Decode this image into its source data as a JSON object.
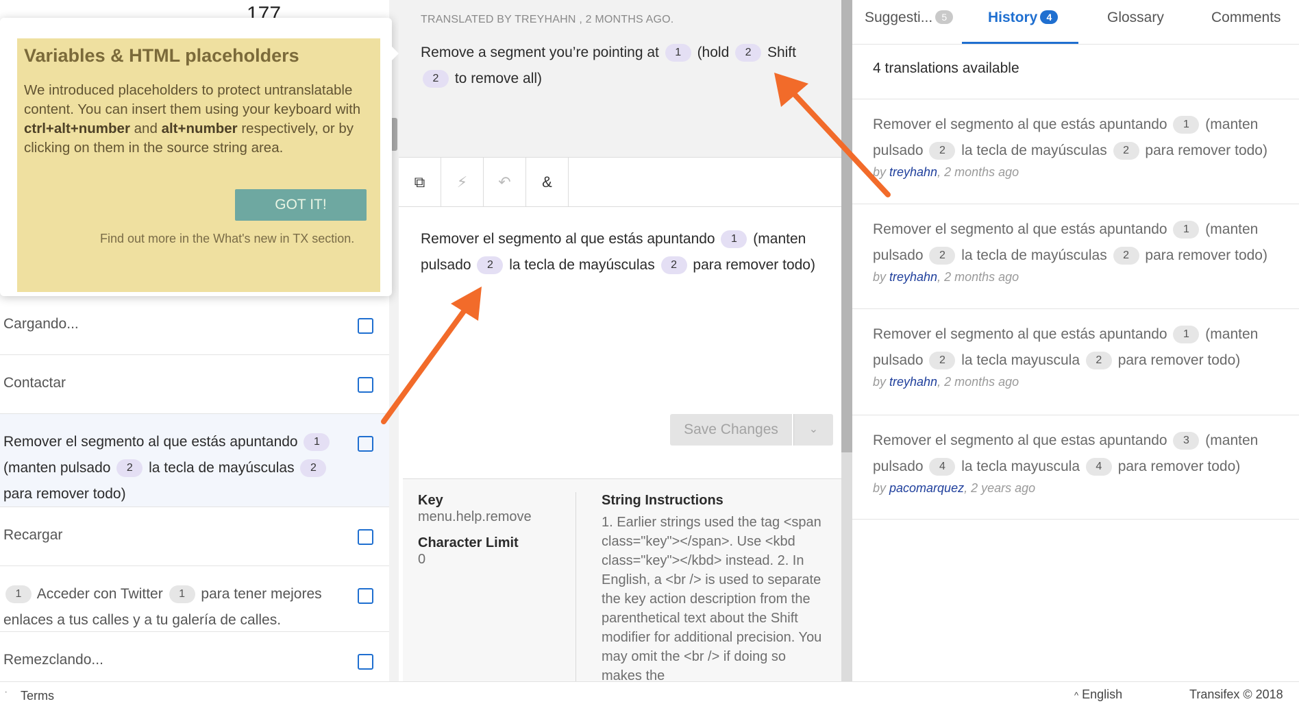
{
  "left": {
    "top_number": "177",
    "items": [
      {
        "text": "Cargando..."
      },
      {
        "text": "Contactar"
      },
      {
        "parts": [
          {
            "t": "Remover el segmento al que estás apuntando"
          },
          {
            "ph": "1"
          },
          {
            "t": "(manten pulsado"
          },
          {
            "ph": "2"
          },
          {
            "t": "la tecla de mayúsculas"
          },
          {
            "ph": "2"
          },
          {
            "t": "para remover todo)"
          }
        ]
      },
      {
        "text": "Recargar"
      },
      {
        "parts": [
          {
            "phg": "1"
          },
          {
            "t": "Acceder con Twitter"
          },
          {
            "phg": "1"
          },
          {
            "t": "para tener mejores enlaces a tus calles y a tu galería de calles."
          }
        ]
      },
      {
        "text": "Remezclando..."
      }
    ]
  },
  "popup": {
    "title": "Variables & HTML placeholders",
    "body_1": "We introduced placeholders to protect untranslatable content. You can insert them using your keyboard with ",
    "body_b1": "ctrl+alt+number",
    "body_2": " and ",
    "body_b2": "alt+number",
    "body_3": " respectively, or by clicking on them in the source string area.",
    "button": "GOT IT!",
    "more": "Find out more in the What's new in TX section."
  },
  "source": {
    "meta": "TRANSLATED BY TREYHAHN , 2 MONTHS AGO.",
    "parts": [
      {
        "t": "Remove a segment you’re pointing at"
      },
      {
        "ph": "1"
      },
      {
        "t": "(hold"
      },
      {
        "ph": "2"
      },
      {
        "t": "Shift"
      },
      {
        "ph": "2"
      },
      {
        "t": "to remove all)"
      }
    ]
  },
  "toolbar": {
    "copy_icon": "⧉",
    "auto_icon": "⚡",
    "undo_icon": "↶",
    "amp_icon": "&"
  },
  "editor": {
    "parts": [
      {
        "t": "Remover el segmento al que estás apuntando"
      },
      {
        "ph": "1"
      },
      {
        "t": "(manten pulsado"
      },
      {
        "ph": "2"
      },
      {
        "t": "la tecla de mayúsculas"
      },
      {
        "ph": "2"
      },
      {
        "t": "para remover todo)"
      }
    ],
    "save_label": "Save Changes",
    "caret": "⌄"
  },
  "details": {
    "key_label": "Key",
    "key_value": "menu.help.remove",
    "limit_label": "Character Limit",
    "limit_value": "0",
    "instr_label": "String Instructions",
    "instr_text": "1. Earlier strings used the tag <span class=\"key\"></span>. Use <kbd class=\"key\"></kbd> instead. 2. In English, a <br /> is used to separate the key action description from the parenthetical text about the Shift modifier for additional precision. You may omit the <br /> if doing so makes the"
  },
  "right": {
    "tabs": {
      "suggestions": "Suggesti...",
      "suggestions_count": "5",
      "history": "History",
      "history_count": "4",
      "glossary": "Glossary",
      "comments": "Comments"
    },
    "available": "4 translations available",
    "history": [
      {
        "parts": [
          {
            "t": "Remover el segmento al que estás apuntando"
          },
          {
            "phg": "1"
          },
          {
            "t": "(manten pulsado"
          },
          {
            "phg": "2"
          },
          {
            "t": "la tecla de mayúsculas"
          },
          {
            "phg": "2"
          },
          {
            "t": "para remover todo)"
          }
        ],
        "by_prefix": "by ",
        "user": "treyhahn",
        "when": ", 2 months ago"
      },
      {
        "parts": [
          {
            "t": "Remover el segmento al que estás apuntando"
          },
          {
            "phg": "1"
          },
          {
            "t": "(manten pulsado"
          },
          {
            "phg": "2"
          },
          {
            "t": "la tecla de mayúsculas"
          },
          {
            "phg": "2"
          },
          {
            "t": "para remover todo)"
          }
        ],
        "by_prefix": "by ",
        "user": "treyhahn",
        "when": ", 2 months ago"
      },
      {
        "parts": [
          {
            "t": "Remover el segmento al que estás apuntando"
          },
          {
            "phg": "1"
          },
          {
            "t": "(manten pulsado"
          },
          {
            "phg": "2"
          },
          {
            "t": "la tecla mayuscula"
          },
          {
            "phg": "2"
          },
          {
            "t": "para remover todo)"
          }
        ],
        "by_prefix": "by ",
        "user": "treyhahn",
        "when": ", 2 months ago"
      },
      {
        "parts": [
          {
            "t": "Remover el segmento al que estas apuntando"
          },
          {
            "phg": "3"
          },
          {
            "t": "(manten pulsado"
          },
          {
            "phg": "4"
          },
          {
            "t": "la tecla mayuscula"
          },
          {
            "phg": "4"
          },
          {
            "t": "para remover todo)"
          }
        ],
        "by_prefix": "by ",
        "user": "pacomarquez",
        "when": ", 2 years ago"
      }
    ]
  },
  "footer": {
    "terms": "Terms",
    "language": "English",
    "lang_caret": "^",
    "copyright": "Transifex © 2018"
  },
  "colors": {
    "accent": "#1f6fd0",
    "annotation_arrow": "#f26b2a",
    "popup_bg": "#efe0a0",
    "gotit_bg": "#6ea8a1",
    "placeholder_bg": "#e4dff4"
  }
}
